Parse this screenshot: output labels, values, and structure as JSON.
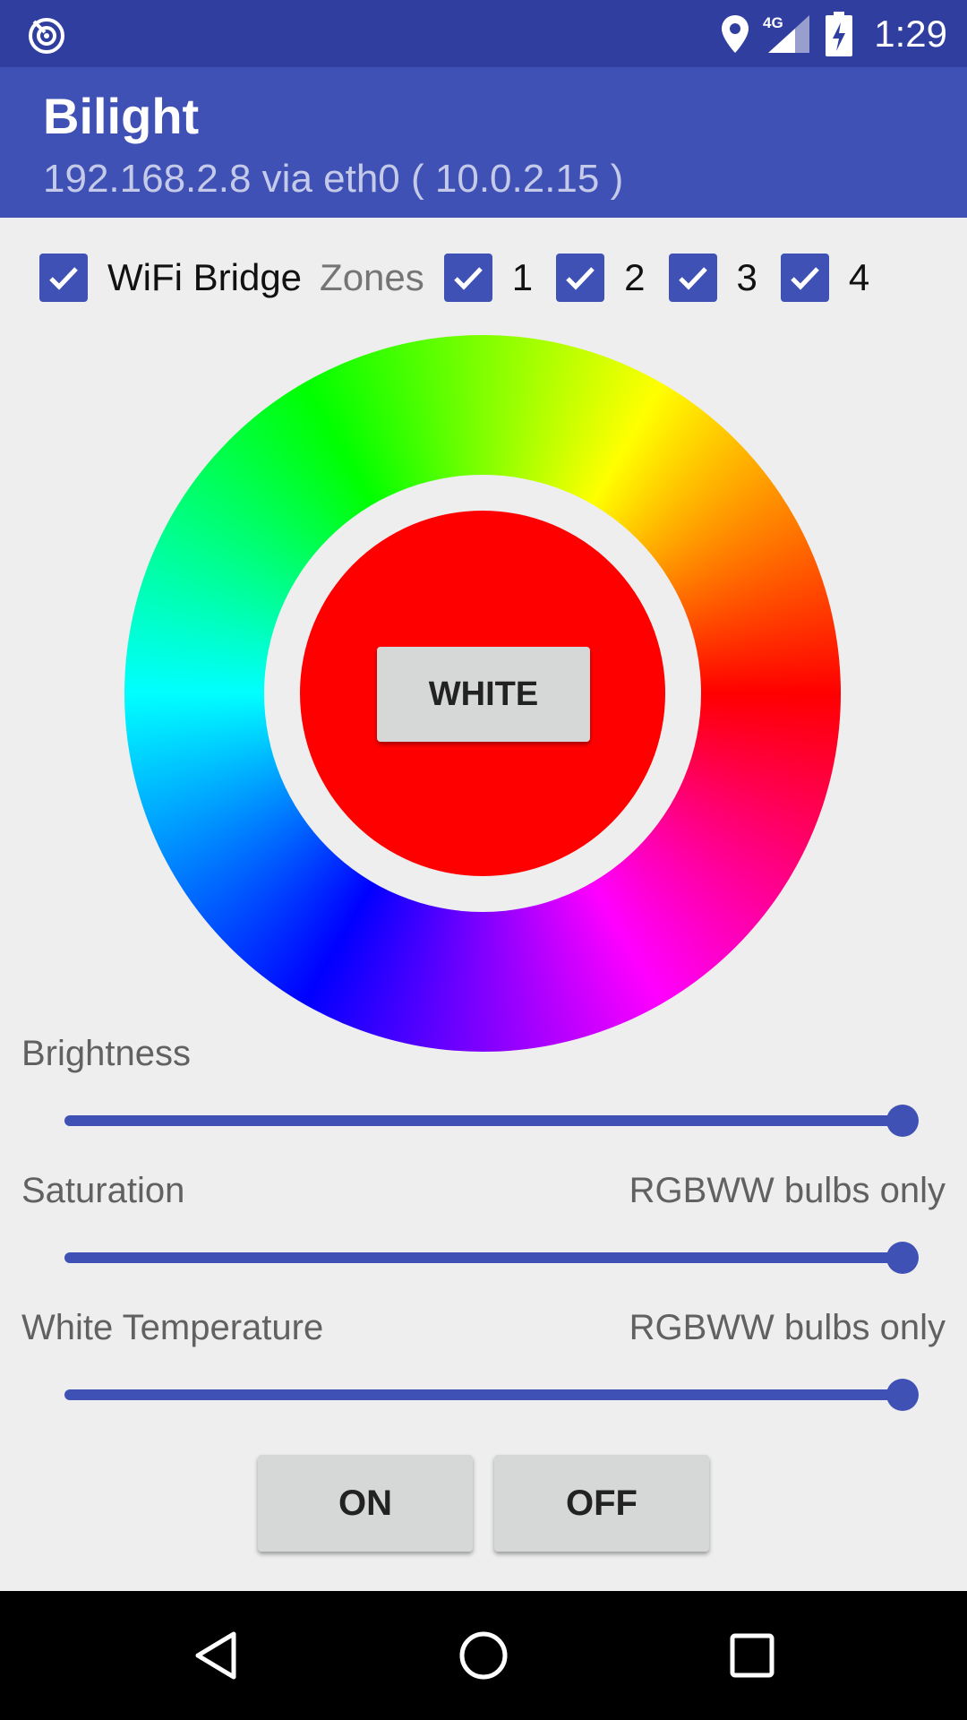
{
  "status_bar": {
    "time": "1:29",
    "network_label": "4G",
    "icons": [
      "app-notification-icon",
      "location-icon",
      "signal-icon",
      "battery-charging-icon"
    ]
  },
  "app_bar": {
    "title": "Bilight",
    "subtitle": "192.168.2.8 via eth0 ( 10.0.2.15 )"
  },
  "bridge": {
    "label": "WiFi Bridge",
    "checked": true
  },
  "zones": {
    "label": "Zones",
    "items": [
      {
        "label": "1",
        "checked": true
      },
      {
        "label": "2",
        "checked": true
      },
      {
        "label": "3",
        "checked": true
      },
      {
        "label": "4",
        "checked": true
      }
    ]
  },
  "color_wheel": {
    "selected_color": "#ff0000",
    "white_button_label": "WHITE"
  },
  "sliders": {
    "brightness": {
      "label": "Brightness",
      "value_fraction": 1.0
    },
    "saturation": {
      "label": "Saturation",
      "note": "RGBWW bulbs only",
      "value_fraction": 1.0
    },
    "white_temperature": {
      "label": "White Temperature",
      "note": "RGBWW bulbs only",
      "value_fraction": 1.0
    }
  },
  "actions": {
    "on_label": "ON",
    "off_label": "OFF"
  },
  "colors": {
    "primary": "#3f51b5",
    "primary_dark": "#303f9f",
    "background": "#eeeeee"
  },
  "nav_bar": {
    "icons": [
      "back-icon",
      "home-icon",
      "recents-icon"
    ]
  }
}
